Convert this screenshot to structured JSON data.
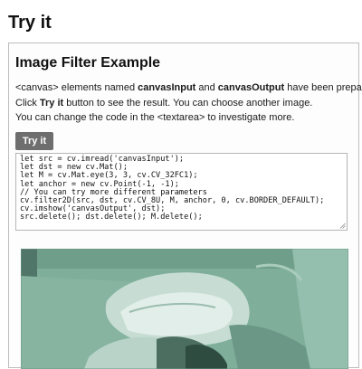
{
  "page": {
    "heading": "Try it"
  },
  "panel": {
    "title": "Image Filter Example",
    "desc": [
      {
        "pre": "<canvas> elements named ",
        "b1": "canvasInput",
        "mid": " and ",
        "b2": "canvasOutput",
        "post": " have been prepared."
      },
      {
        "pre": "Click ",
        "b1": "Try it",
        "post": " button to see the result. You can choose another image."
      },
      {
        "text": "You can change the code in the <textarea> to investigate more."
      }
    ],
    "try_button_label": "Try it",
    "code_lines": [
      "let src = cv.imread('canvasInput');",
      "let dst = new cv.Mat();",
      "let M = cv.Mat.eye(3, 3, cv.CV_32FC1);",
      "let anchor = new cv.Point(-1, -1);",
      "// You can try more different parameters",
      "cv.filter2D(src, dst, cv.CV_8U, M, anchor, 0, cv.BORDER_DEFAULT);",
      "cv.imshow('canvasOutput', dst);",
      "src.delete(); dst.delete(); M.delete();"
    ]
  },
  "colors": {
    "image_bg": "#7dab98",
    "image_dark": "#3d5a4e",
    "image_light": "#c9dfd6",
    "button_bg": "#6e6e6e"
  }
}
